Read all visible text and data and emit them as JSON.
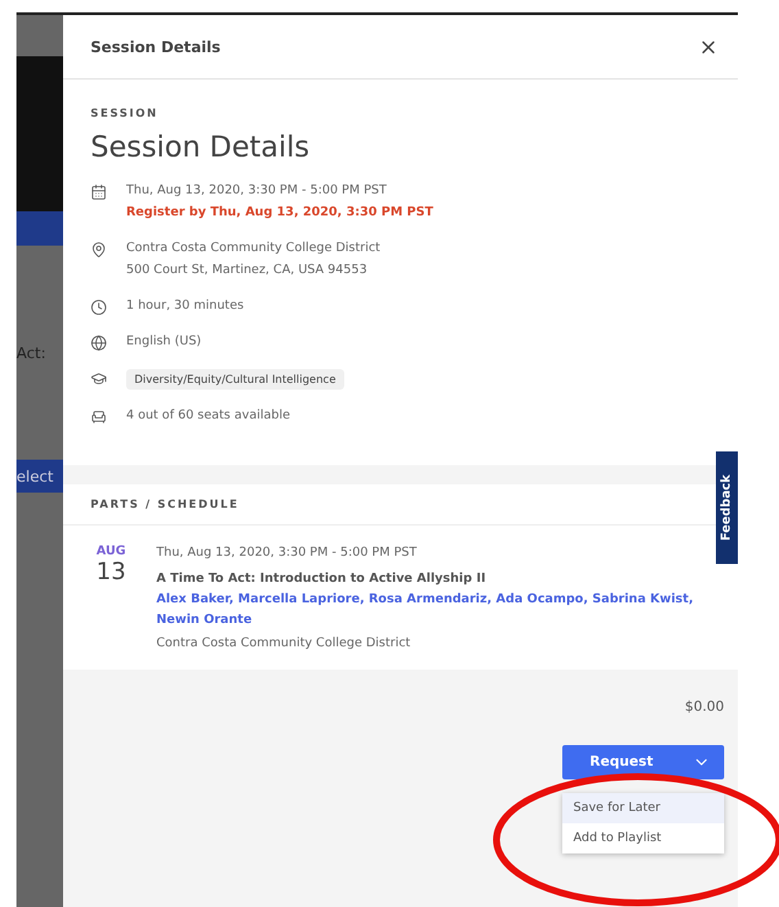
{
  "background": {
    "texts": [
      "Act:",
      "elect"
    ]
  },
  "header": {
    "title": "Session Details"
  },
  "session": {
    "eyebrow": "SESSION",
    "title": "Session Details",
    "details": [
      {
        "kind": "date",
        "lines": [
          "Thu, Aug 13, 2020, 3:30 PM - 5:00 PM PST"
        ],
        "note": "Register by Thu, Aug 13, 2020, 3:30 PM PST"
      },
      {
        "kind": "location",
        "lines": [
          "Contra Costa Community College District",
          "500 Court St, Martinez, CA, USA 94553"
        ]
      },
      {
        "kind": "duration",
        "lines": [
          "1 hour, 30 minutes"
        ]
      },
      {
        "kind": "language",
        "lines": [
          "English (US)"
        ]
      },
      {
        "kind": "category",
        "lines": [
          "Diversity/Equity/Cultural Intelligence"
        ]
      },
      {
        "kind": "seats",
        "lines": [
          "4 out of 60 seats available"
        ]
      }
    ]
  },
  "parts": {
    "heading": "PARTS / SCHEDULE",
    "items": [
      {
        "month": "AUG",
        "day": "13",
        "time": "Thu, Aug 13, 2020, 3:30 PM - 5:00 PM PST",
        "title": "A Time To Act: Introduction to Active Allyship II",
        "presenters": "Alex Baker, Marcella Lapriore, Rosa Armendariz, Ada Ocampo, Sabrina Kwist, Newin Orante",
        "location": "Contra Costa Community College District"
      }
    ]
  },
  "footer": {
    "price": "$0.00",
    "button": "Request",
    "menu": [
      {
        "label": "Save for Later",
        "selected": true
      },
      {
        "label": "Add to Playlist",
        "selected": false
      }
    ]
  },
  "feedback_tab": "Feedback"
}
